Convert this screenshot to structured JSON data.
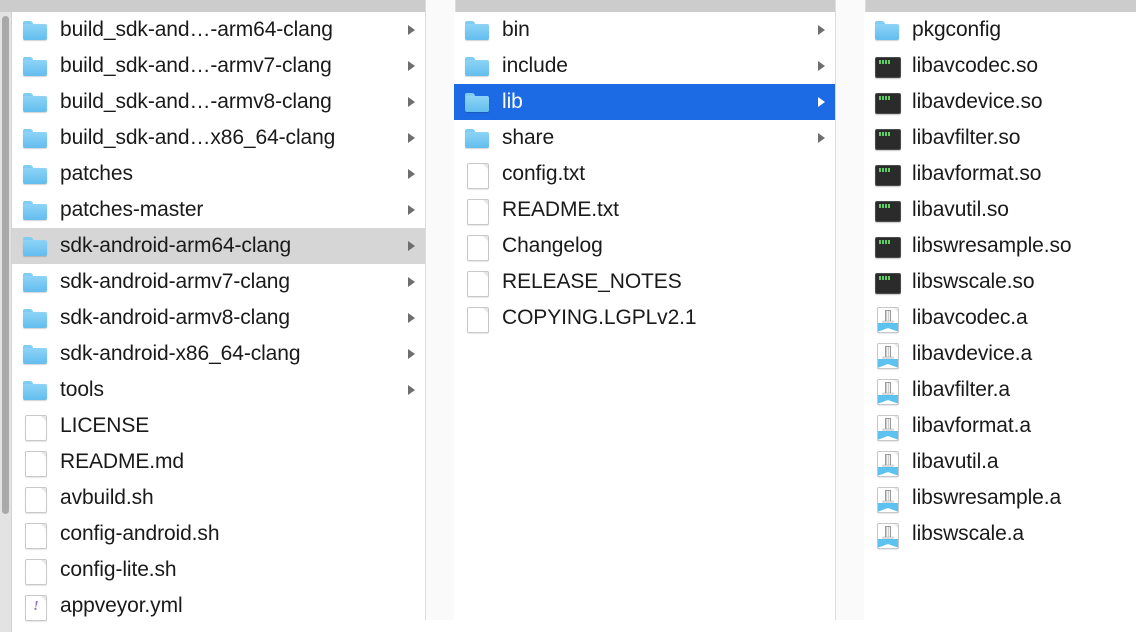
{
  "window": {
    "view": "column-view",
    "accent_selected": "#1d6ae5",
    "accent_selected_inactive": "#d6d6d6",
    "chrome_color": "#cccccc"
  },
  "scrollbar": {
    "name": "vertical-scrollbar",
    "orientation": "vertical",
    "position": "left"
  },
  "columns": [
    {
      "name": "column-1",
      "items": [
        {
          "label": "build_sdk-and…-arm64-clang",
          "icon": "folder-icon",
          "has_chevron": true,
          "selected": false
        },
        {
          "label": "build_sdk-and…-armv7-clang",
          "icon": "folder-icon",
          "has_chevron": true,
          "selected": false
        },
        {
          "label": "build_sdk-and…-armv8-clang",
          "icon": "folder-icon",
          "has_chevron": true,
          "selected": false
        },
        {
          "label": "build_sdk-and…x86_64-clang",
          "icon": "folder-icon",
          "has_chevron": true,
          "selected": false
        },
        {
          "label": "patches",
          "icon": "folder-icon",
          "has_chevron": true,
          "selected": false
        },
        {
          "label": "patches-master",
          "icon": "folder-icon",
          "has_chevron": true,
          "selected": false
        },
        {
          "label": "sdk-android-arm64-clang",
          "icon": "folder-icon",
          "has_chevron": true,
          "selected": "inactive"
        },
        {
          "label": "sdk-android-armv7-clang",
          "icon": "folder-icon",
          "has_chevron": true,
          "selected": false
        },
        {
          "label": "sdk-android-armv8-clang",
          "icon": "folder-icon",
          "has_chevron": true,
          "selected": false
        },
        {
          "label": "sdk-android-x86_64-clang",
          "icon": "folder-icon",
          "has_chevron": true,
          "selected": false
        },
        {
          "label": "tools",
          "icon": "folder-icon",
          "has_chevron": true,
          "selected": false
        },
        {
          "label": "LICENSE",
          "icon": "document-icon",
          "has_chevron": false,
          "selected": false
        },
        {
          "label": "README.md",
          "icon": "markdown-document-icon",
          "has_chevron": false,
          "selected": false
        },
        {
          "label": "avbuild.sh",
          "icon": "document-icon",
          "has_chevron": false,
          "selected": false
        },
        {
          "label": "config-android.sh",
          "icon": "document-icon",
          "has_chevron": false,
          "selected": false
        },
        {
          "label": "config-lite.sh",
          "icon": "document-icon",
          "has_chevron": false,
          "selected": false
        },
        {
          "label": "appveyor.yml",
          "icon": "yaml-document-icon",
          "has_chevron": false,
          "selected": false
        }
      ]
    },
    {
      "name": "column-2",
      "items": [
        {
          "label": "bin",
          "icon": "folder-icon",
          "has_chevron": true,
          "selected": false
        },
        {
          "label": "include",
          "icon": "folder-icon",
          "has_chevron": true,
          "selected": false
        },
        {
          "label": "lib",
          "icon": "folder-icon",
          "has_chevron": true,
          "selected": "active"
        },
        {
          "label": "share",
          "icon": "folder-icon",
          "has_chevron": true,
          "selected": false
        },
        {
          "label": "config.txt",
          "icon": "text-document-icon",
          "has_chevron": false,
          "selected": false
        },
        {
          "label": "README.txt",
          "icon": "text-document-icon",
          "has_chevron": false,
          "selected": false
        },
        {
          "label": "Changelog",
          "icon": "document-icon",
          "has_chevron": false,
          "selected": false
        },
        {
          "label": "RELEASE_NOTES",
          "icon": "document-icon",
          "has_chevron": false,
          "selected": false
        },
        {
          "label": "COPYING.LGPLv2.1",
          "icon": "document-icon",
          "has_chevron": false,
          "selected": false
        }
      ]
    },
    {
      "name": "column-3",
      "items": [
        {
          "label": "pkgconfig",
          "icon": "folder-icon",
          "has_chevron": false,
          "selected": false
        },
        {
          "label": "libavcodec.so",
          "icon": "terminal-icon",
          "has_chevron": false,
          "selected": false
        },
        {
          "label": "libavdevice.so",
          "icon": "terminal-icon",
          "has_chevron": false,
          "selected": false
        },
        {
          "label": "libavfilter.so",
          "icon": "terminal-icon",
          "has_chevron": false,
          "selected": false
        },
        {
          "label": "libavformat.so",
          "icon": "terminal-icon",
          "has_chevron": false,
          "selected": false
        },
        {
          "label": "libavutil.so",
          "icon": "terminal-icon",
          "has_chevron": false,
          "selected": false
        },
        {
          "label": "libswresample.so",
          "icon": "terminal-icon",
          "has_chevron": false,
          "selected": false
        },
        {
          "label": "libswscale.so",
          "icon": "terminal-icon",
          "has_chevron": false,
          "selected": false
        },
        {
          "label": "libavcodec.a",
          "icon": "archive-icon",
          "has_chevron": false,
          "selected": false
        },
        {
          "label": "libavdevice.a",
          "icon": "archive-icon",
          "has_chevron": false,
          "selected": false
        },
        {
          "label": "libavfilter.a",
          "icon": "archive-icon",
          "has_chevron": false,
          "selected": false
        },
        {
          "label": "libavformat.a",
          "icon": "archive-icon",
          "has_chevron": false,
          "selected": false
        },
        {
          "label": "libavutil.a",
          "icon": "archive-icon",
          "has_chevron": false,
          "selected": false
        },
        {
          "label": "libswresample.a",
          "icon": "archive-icon",
          "has_chevron": false,
          "selected": false
        },
        {
          "label": "libswscale.a",
          "icon": "archive-icon",
          "has_chevron": false,
          "selected": false
        }
      ]
    }
  ]
}
